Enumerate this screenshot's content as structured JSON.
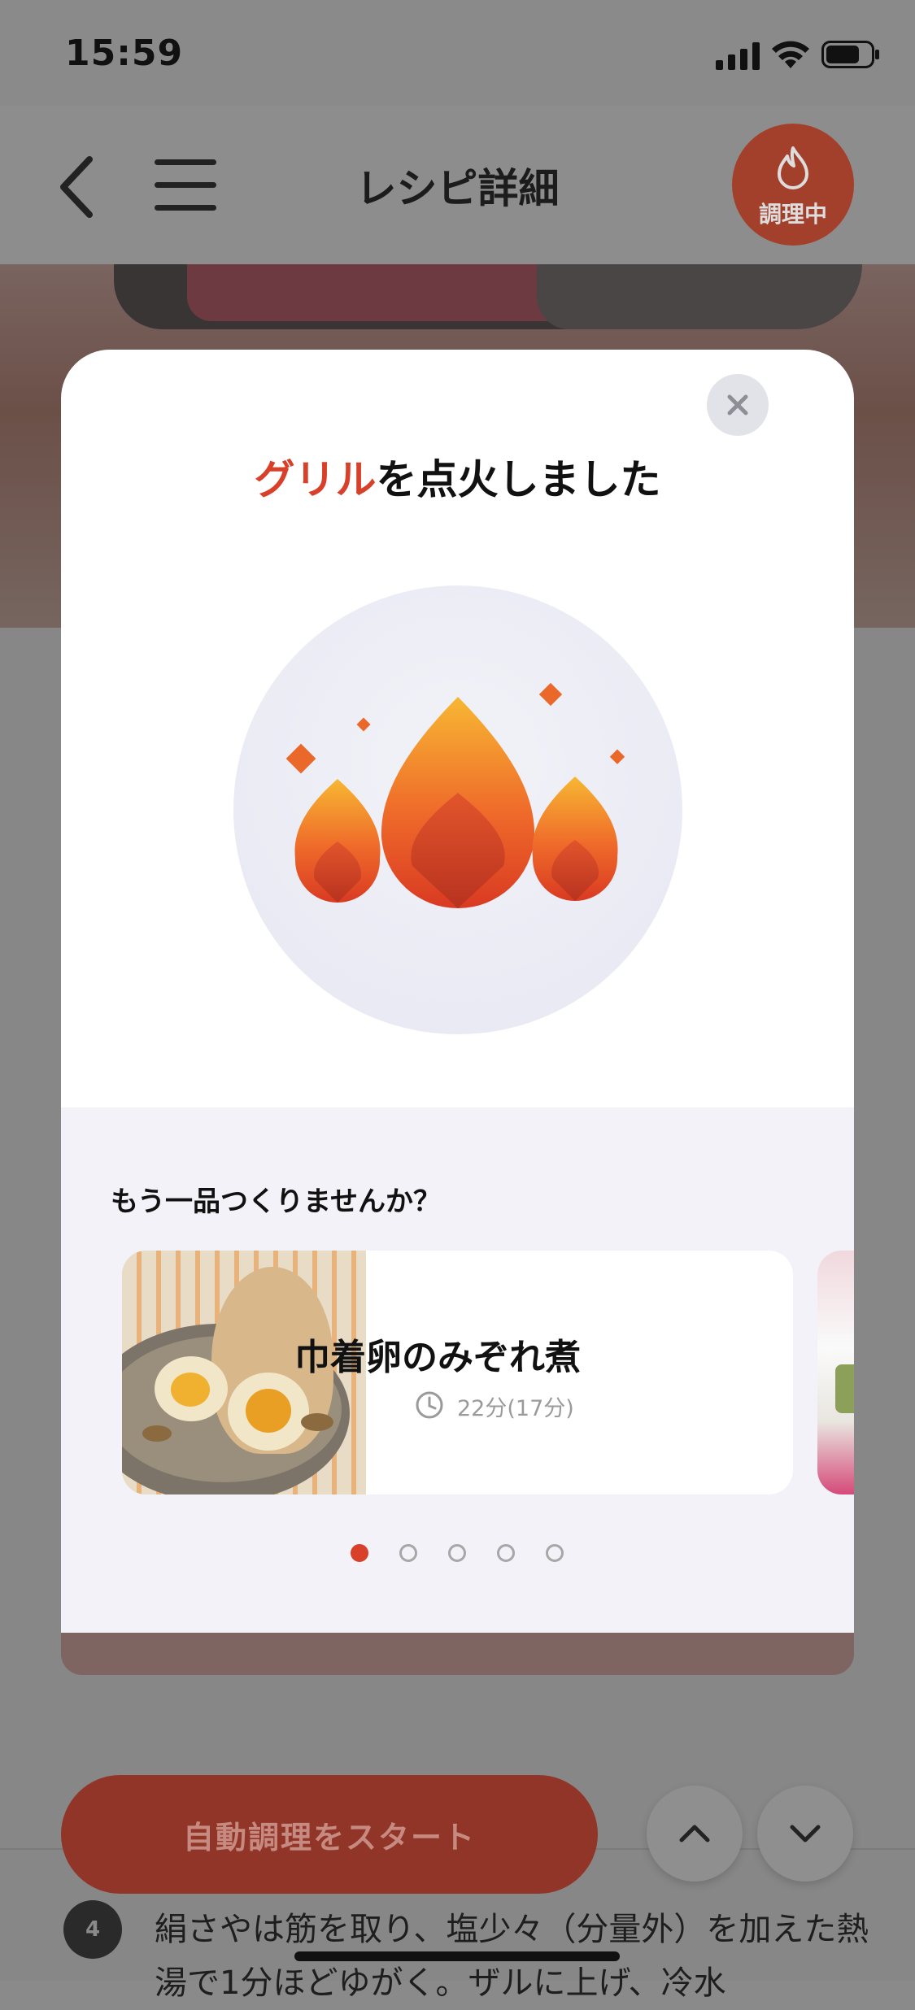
{
  "status_bar": {
    "time": "15:59"
  },
  "nav": {
    "title": "レシピ詳細",
    "cooking_badge": "調理中"
  },
  "modal": {
    "title_highlight": "グリル",
    "title_rest": "を点火しました",
    "suggestion_heading": "もう一品つくりませんか？",
    "recipe": {
      "name": "巾着卵のみぞれ煮",
      "time": "22分(17分)"
    },
    "pager": {
      "count": 5,
      "active_index": 0
    }
  },
  "footer": {
    "start_button": "自動調理をスタート",
    "step_number": "4",
    "step_text": "絹さやは筋を取り、塩少々（分量外）を加えた熱湯で1分ほどゆがく。ザルに上げ、冷水"
  },
  "colors": {
    "accent": "#d8402a",
    "overlay": "#8a8a8a",
    "modal_bg": "#ffffff",
    "suggest_bg": "#f2f2f8"
  }
}
